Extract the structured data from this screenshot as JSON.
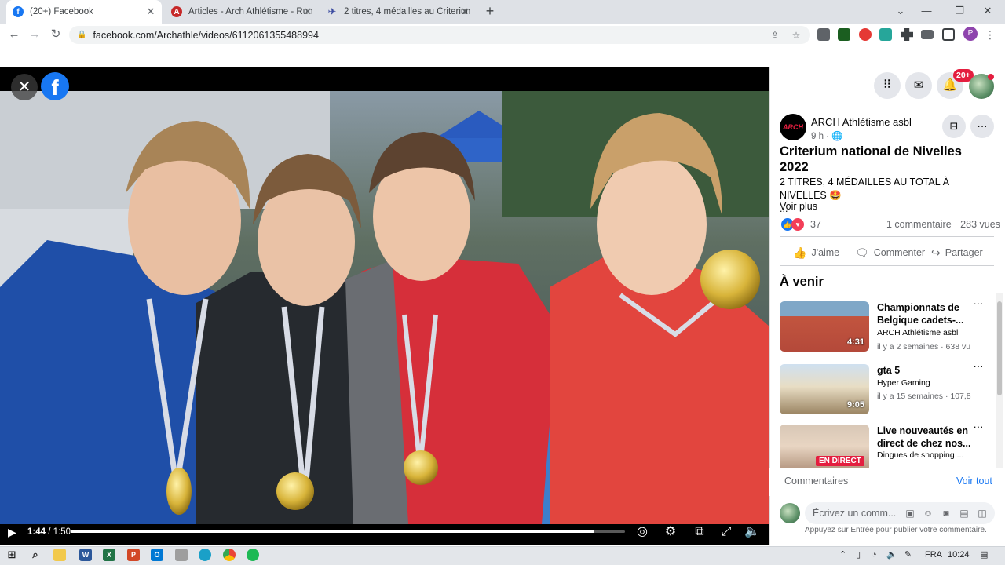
{
  "browser": {
    "tabs": [
      {
        "title": "(20+) Facebook",
        "favicon": "facebook-icon",
        "active": true
      },
      {
        "title": "Articles - Arch Athlétisme - Runn",
        "favicon": "arch-icon",
        "active": false
      },
      {
        "title": "2 titres, 4 médailles au Criterium",
        "favicon": "runner-icon",
        "active": false
      }
    ],
    "url": "facebook.com/Archathle/videos/6112061355488994"
  },
  "video": {
    "current_time": "1:44",
    "duration": "1:50",
    "progress": 0.945
  },
  "header": {
    "notification_badge": "20+"
  },
  "post": {
    "page_name": "ARCH Athlétisme asbl",
    "page_avatar_text": "ARCH",
    "time": "9 h ·",
    "title": "Criterium national de Nivelles 2022",
    "text": "2 TITRES, 4 MÉDAILLES AU TOTAL À NIVELLES 🤩",
    "ellipsis": "...",
    "see_more": "Voir plus",
    "reaction_count": "37",
    "comments": "1 commentaire",
    "views": "283 vues",
    "actions": {
      "like": "J'aime",
      "comment": "Commenter",
      "share": "Partager"
    }
  },
  "upcoming": {
    "heading": "À venir",
    "items": [
      {
        "title": "Championnats de Belgique cadets-...",
        "channel": "ARCH Athlétisme asbl",
        "meta": "il y a 2 semaines · 638 vu",
        "duration": "4:31"
      },
      {
        "title": "gta 5",
        "channel": "Hyper Gaming",
        "meta": "il y a 15 semaines · 107,8",
        "duration": "9:05"
      },
      {
        "title": "Live nouveautés en direct de chez nos...",
        "channel": "Dingues de shopping ...",
        "meta": "",
        "live_label": "EN DIRECT"
      }
    ]
  },
  "comments": {
    "label": "Commentaires",
    "see_all": "Voir tout",
    "placeholder": "Écrivez un comm...",
    "hint": "Appuyez sur Entrée pour publier votre commentaire."
  },
  "taskbar": {
    "language": "FRA",
    "time": "10:24"
  },
  "colors": {
    "facebook_blue": "#1877f2",
    "badge_red": "#e41e3f",
    "like_blue": "#1877f2",
    "love_red": "#f33e58"
  }
}
